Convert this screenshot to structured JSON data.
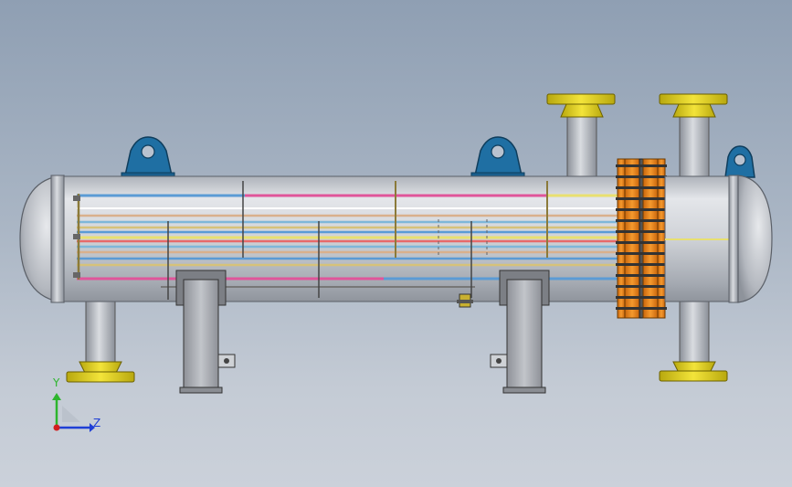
{
  "axes": {
    "y_label": "Y",
    "z_label": "Z",
    "y_color": "#2db52d",
    "z_color": "#1f3fd6",
    "origin_color": "#d21f1f"
  },
  "colors": {
    "background_top": "#8f9fb3",
    "background_bottom": "#cbd1da",
    "shell": "#c9ccd1",
    "nozzle_flange": "#e2d21a",
    "lifting_lug": "#1f6fa3",
    "tubesheet_flange": "#f08a1c",
    "saddle": "#a6a6a6",
    "tube_colors": [
      "#5b9bd5",
      "#e0559a",
      "#e8e070",
      "#d9b08c",
      "#7fb7d9",
      "#e86a6a",
      "#d6c27a"
    ]
  }
}
